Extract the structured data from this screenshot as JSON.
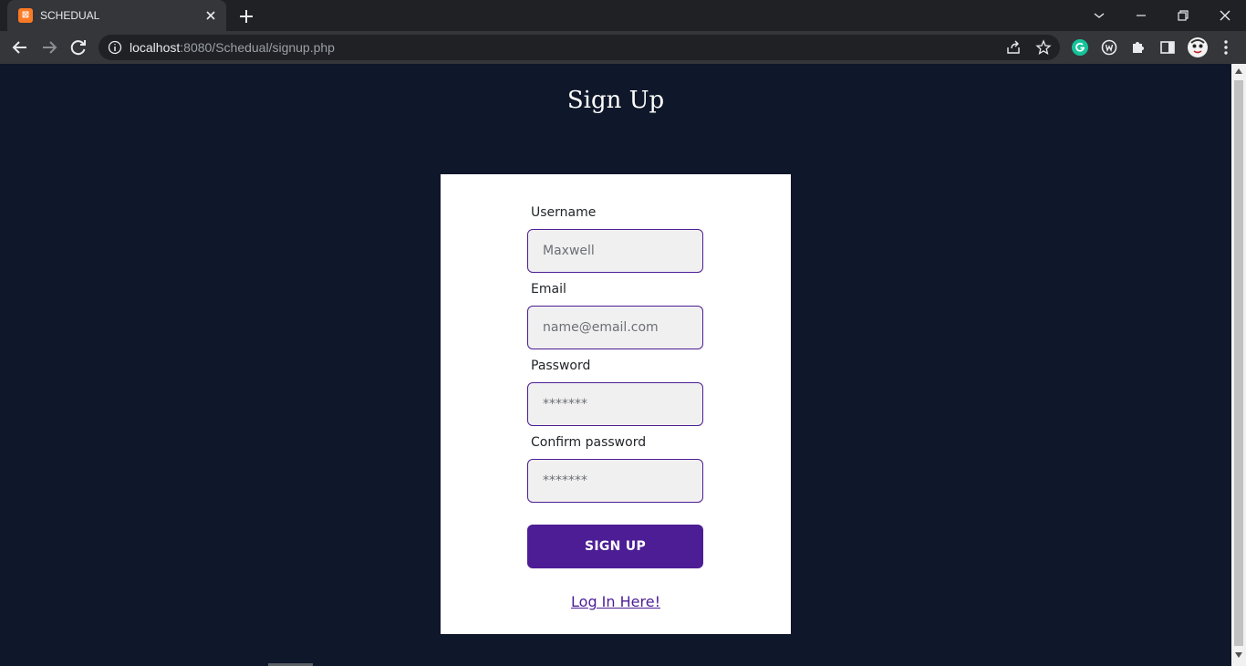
{
  "browser": {
    "tab": {
      "title": "SCHEDUAL",
      "favicon_glyph": "⊠"
    },
    "url": {
      "host": "localhost",
      "path": ":8080/Schedual/signup.php"
    },
    "icons": {
      "tab_close": "close-icon",
      "new_tab": "plus-icon",
      "tab_search": "chevron-down-icon",
      "minimize": "minimize-icon",
      "restore": "restore-icon",
      "close_window": "close-icon",
      "back": "arrow-left-icon",
      "forward": "arrow-right-icon",
      "reload": "reload-icon",
      "site_info": "info-icon",
      "share": "share-icon",
      "bookmark": "star-icon",
      "grammarly": "grammarly-icon",
      "wordtune": "wordtune-icon",
      "extensions": "puzzle-icon",
      "side_panel": "side-panel-icon",
      "profile": "avatar",
      "menu": "kebab-menu-icon"
    }
  },
  "page": {
    "title": "Sign Up",
    "form": {
      "username": {
        "label": "Username",
        "placeholder": "Maxwell"
      },
      "email": {
        "label": "Email",
        "placeholder": "name@email.com"
      },
      "password": {
        "label": "Password",
        "placeholder": "*******"
      },
      "confirm_password": {
        "label": "Confirm password",
        "placeholder": "*******"
      },
      "submit_label": "SIGN UP",
      "login_link": "Log In Here!"
    }
  },
  "colors": {
    "page_background": "#0f172a",
    "card_background": "#ffffff",
    "accent": "#4c1d95",
    "input_background": "#f1f0f0"
  }
}
